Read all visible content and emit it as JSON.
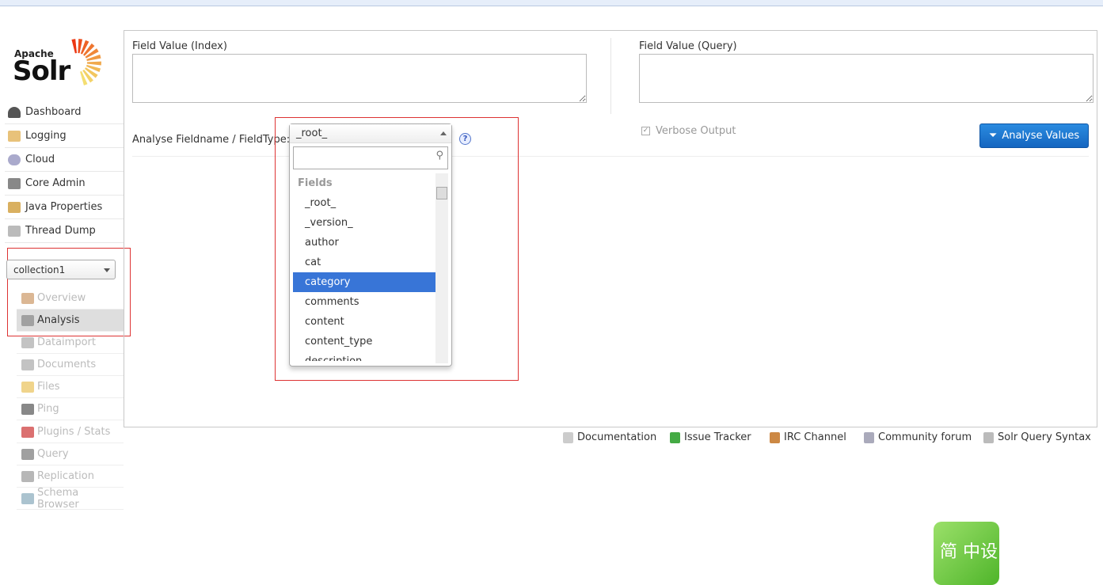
{
  "logo": {
    "apache": "Apache",
    "solr": "Solr"
  },
  "nav": [
    {
      "label": "Dashboard",
      "icon": "dashboard-icon"
    },
    {
      "label": "Logging",
      "icon": "logging-icon"
    },
    {
      "label": "Cloud",
      "icon": "cloud-icon"
    },
    {
      "label": "Core Admin",
      "icon": "core-admin-icon"
    },
    {
      "label": "Java Properties",
      "icon": "java-icon"
    },
    {
      "label": "Thread Dump",
      "icon": "thread-dump-icon"
    }
  ],
  "core_selector": {
    "value": "collection1"
  },
  "core_menu": [
    {
      "label": "Overview"
    },
    {
      "label": "Analysis",
      "active": true
    },
    {
      "label": "Dataimport"
    },
    {
      "label": "Documents"
    },
    {
      "label": "Files"
    },
    {
      "label": "Ping"
    },
    {
      "label": "Plugins / Stats"
    },
    {
      "label": "Query"
    },
    {
      "label": "Replication"
    },
    {
      "label": "Schema Browser"
    }
  ],
  "main": {
    "index_label": "Field Value (Index)",
    "query_label": "Field Value (Query)",
    "index_value": "",
    "query_value": "",
    "fieldtype_label": "Analyse Fieldname / FieldType:",
    "verbose_label": "Verbose Output",
    "verbose_checked": true,
    "analyse_button": "Analyse Values"
  },
  "dropdown": {
    "selected": "_root_",
    "search": "",
    "group": "Fields",
    "options": [
      "_root_",
      "_version_",
      "author",
      "cat",
      "category",
      "comments",
      "content",
      "content_type",
      "description"
    ],
    "highlighted": "category"
  },
  "footer": [
    {
      "label": "Documentation"
    },
    {
      "label": "Issue Tracker"
    },
    {
      "label": "IRC Channel"
    },
    {
      "label": "Community forum"
    },
    {
      "label": "Solr Query Syntax"
    }
  ],
  "badge": {
    "text": "简 中设"
  },
  "colors": {
    "accent": "#1a73cc",
    "highlight": "#3875d7",
    "annotation": "#dd3333"
  }
}
